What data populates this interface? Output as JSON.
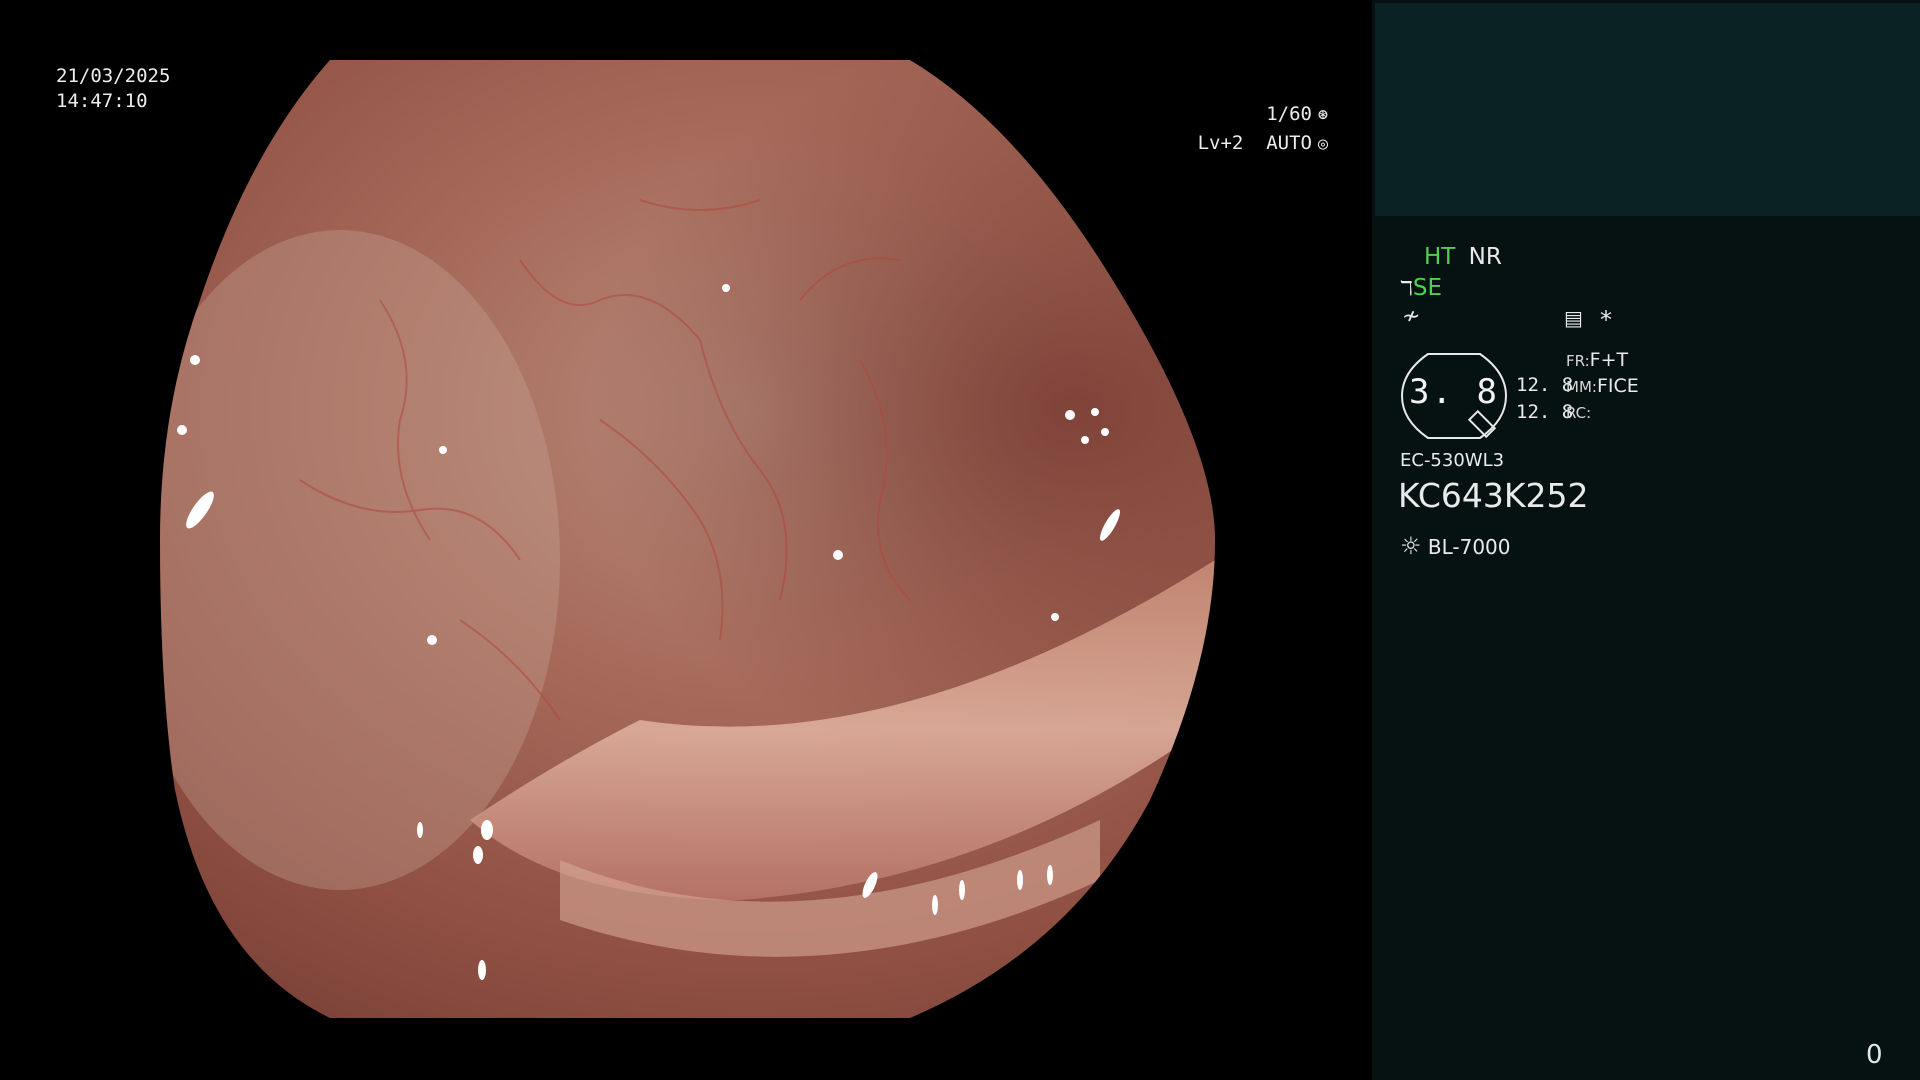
{
  "overlay": {
    "date": "21/03/2025",
    "time": "14:47:10",
    "shutter": "1/60",
    "shutter_icon": "shutter-icon",
    "iris": "Lv+2  AUTO",
    "iris_icon": "iris-icon"
  },
  "panel": {
    "ht": "HT",
    "nr": "NR",
    "se": "SE",
    "se_icon": "scope-tip-icon",
    "enhance_icon": "enhance-icon",
    "settings_icon": "menu-icon",
    "star": "*",
    "zoom_value": "3. 8",
    "val_top": "12. 8",
    "val_bottom": "12. 8",
    "fr_label": "FR:",
    "fr_value": "F+T",
    "mm_label": "MM:",
    "mm_value": "FICE",
    "rc_label": "RC:",
    "rc_value": "",
    "scope_model": "EC-530WL3",
    "serial": "KC643K252",
    "light_icon": "light-source-icon",
    "light_source": "BL-7000"
  },
  "counter": "0",
  "colors": {
    "highlight": "#4fd04f",
    "panel_bg": "#061212",
    "thumb_bg": "#0a2224"
  }
}
